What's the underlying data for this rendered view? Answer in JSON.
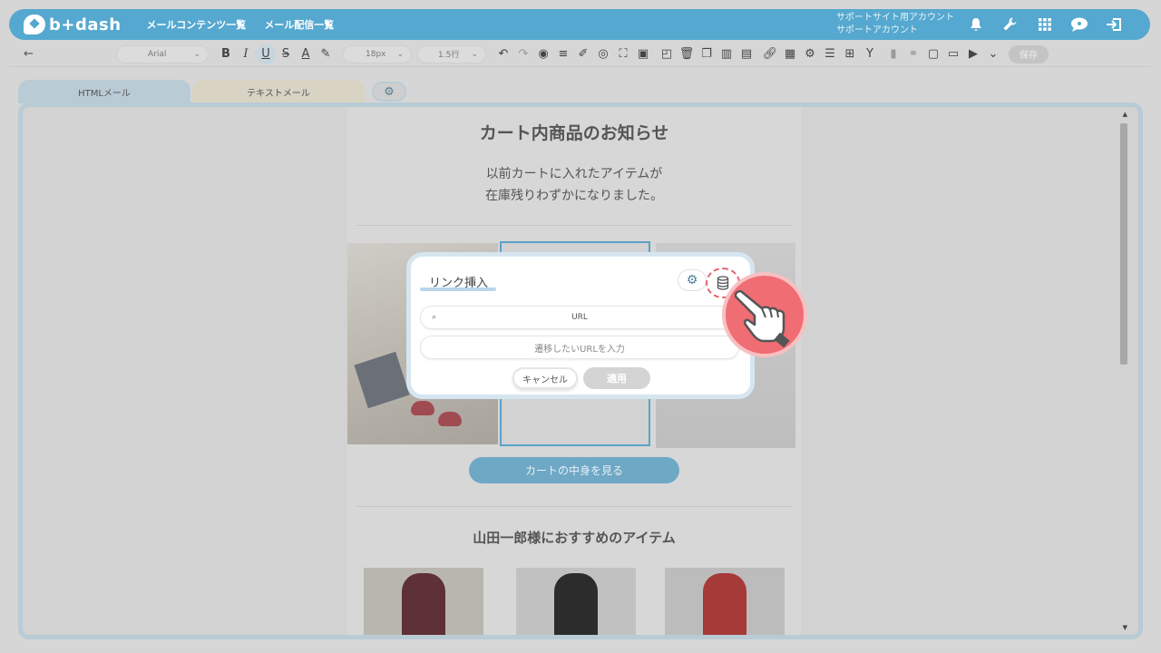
{
  "header": {
    "logo_text": "b+dash",
    "nav": [
      "メールコンテンツ一覧",
      "メール配信一覧"
    ],
    "account_line1": "サポートサイト用アカウント",
    "account_line2": "サポートアカウント",
    "icons": [
      "bell-icon",
      "wrench-icon",
      "apps-grid-icon",
      "chat-icon",
      "logout-icon"
    ]
  },
  "toolbar": {
    "back_icon": "←",
    "font_family": "Arial",
    "font_size": "18px",
    "line_height": "1.5行",
    "bold": "B",
    "italic": "I",
    "underline": "U",
    "strike": "S",
    "text_color": "A",
    "save_label": "保存"
  },
  "tabs": {
    "html": "HTMLメール",
    "text": "テキストメール"
  },
  "mail": {
    "title": "カート内商品のお知らせ",
    "subtitle_line1": "以前カートに入れたアイテムが",
    "subtitle_line2": "在庫残りわずかになりました。",
    "cart_button": "カートの中身を見る",
    "reco_title": "山田一郎様におすすめのアイテム"
  },
  "modal": {
    "title": "リンク挿入",
    "url_label": "URL",
    "url_placeholder": "遷移したいURLを入力",
    "cancel": "キャンセル",
    "apply": "適用",
    "icons": [
      "gear-icon",
      "database-icon"
    ]
  },
  "colors": {
    "brand": "#55a8cf",
    "highlight": "#ef6d73"
  }
}
